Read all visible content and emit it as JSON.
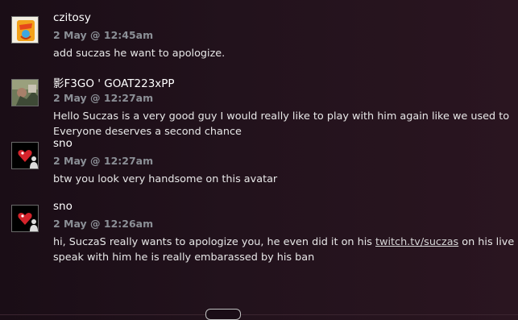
{
  "comments": [
    {
      "author": "czitosy",
      "timestamp": "2 May @ 12:45am",
      "lines": [
        "add suczas he want to apologize."
      ],
      "avatar_icon": "cheetos-avatar-icon"
    },
    {
      "author": "影F3GO ' GOAT223xPP",
      "timestamp": "2 May @ 12:27am",
      "lines": [
        "Hello Suczas is a very good guy I would really like to play with him again like we used to",
        "Everyone deserves a second chance"
      ],
      "avatar_icon": "photo-avatar-icon"
    },
    {
      "author": "sno",
      "timestamp": "2 May @ 12:27am",
      "lines": [
        "btw you look very handsome on this avatar"
      ],
      "avatar_icon": "red-heart-avatar-icon"
    },
    {
      "author": "sno",
      "timestamp": "2 May @ 12:26am",
      "line1_before": "hi, SuczaS really wants to apologize you, he even did it on his ",
      "line1_link": "twitch.tv/suczas",
      "line1_after": " on his live now,",
      "line2": "speak with him he is really embarassed by his ban",
      "avatar_icon": "red-heart-avatar-icon"
    }
  ],
  "colors": {
    "background": "#22121c",
    "timestamp": "#8b8f96",
    "author": "#ffffff",
    "text": "#e8e8e8"
  }
}
